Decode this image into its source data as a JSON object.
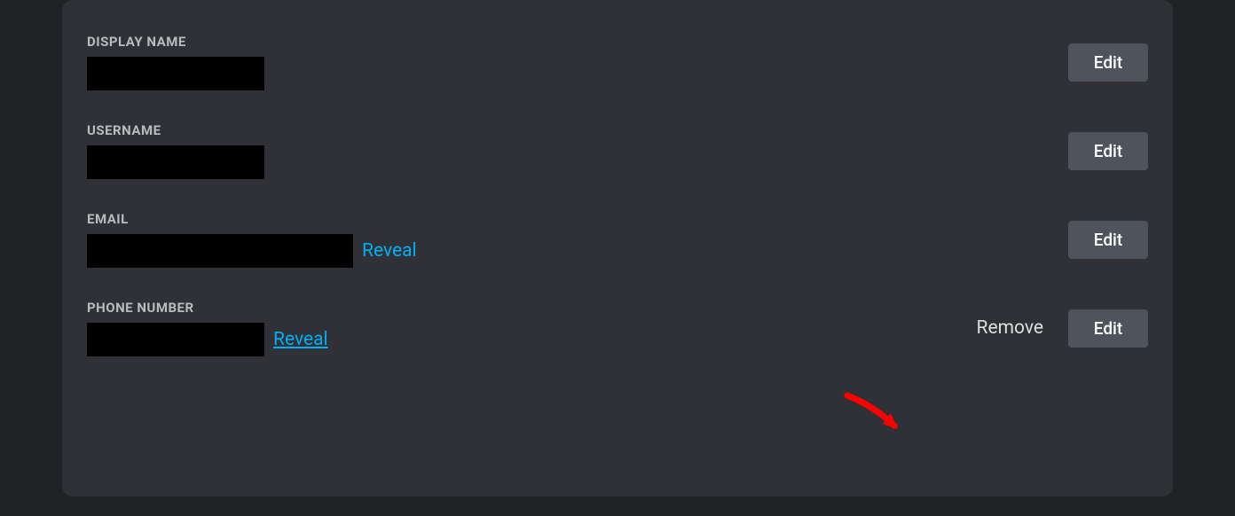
{
  "fields": {
    "display_name": {
      "label": "DISPLAY NAME",
      "edit_label": "Edit"
    },
    "username": {
      "label": "USERNAME",
      "edit_label": "Edit"
    },
    "email": {
      "label": "EMAIL",
      "reveal_label": "Reveal",
      "edit_label": "Edit"
    },
    "phone": {
      "label": "PHONE NUMBER",
      "reveal_label": "Reveal",
      "remove_label": "Remove",
      "edit_label": "Edit"
    }
  },
  "colors": {
    "background": "#202225",
    "panel": "#2f3136",
    "label": "#b9bbbe",
    "link": "#00aff4",
    "text": "#dcddde",
    "button": "#4f545c",
    "arrow": "#ff0000"
  }
}
